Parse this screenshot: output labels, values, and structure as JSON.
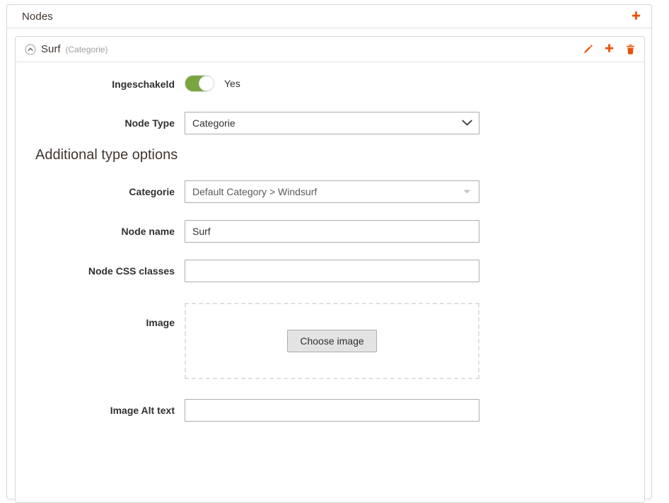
{
  "panel": {
    "title": "Nodes",
    "add_icon": "plus-icon"
  },
  "node": {
    "collapse_icon": "chevron-up-circle-icon",
    "title": "Surf",
    "subtitle": "(Categorie)",
    "actions": [
      {
        "name": "edit-node-button",
        "icon": "pencil-icon"
      },
      {
        "name": "add-child-node-button",
        "icon": "plus-icon"
      },
      {
        "name": "delete-node-button",
        "icon": "trash-icon"
      }
    ]
  },
  "form": {
    "enabled": {
      "label": "Ingeschakeld",
      "state_text": "Yes",
      "checked": true
    },
    "node_type": {
      "label": "Node Type",
      "value": "Categorie",
      "icon": "chevron-down-icon"
    },
    "section_title": "Additional type options",
    "categorie": {
      "label": "Categorie",
      "value": "Default Category > Windsurf",
      "icon": "caret-down-icon"
    },
    "node_name": {
      "label": "Node name",
      "value": "Surf",
      "placeholder": ""
    },
    "node_css_classes": {
      "label": "Node CSS classes",
      "value": "",
      "placeholder": ""
    },
    "image": {
      "label": "Image",
      "button_label": "Choose image"
    },
    "image_alt_text": {
      "label": "Image Alt text",
      "value": "",
      "placeholder": ""
    }
  },
  "colors": {
    "accent": "#eb5202",
    "toggle_on": "#79a540",
    "text": "#303030",
    "muted": "#a0a0a0",
    "border": "#adadad"
  }
}
